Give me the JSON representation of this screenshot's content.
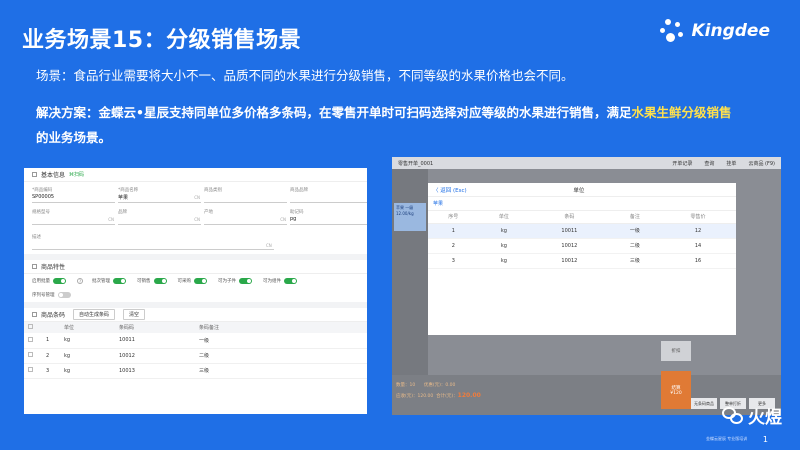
{
  "title": "业务场景15：分级销售场景",
  "brand": "Kingdee",
  "scene_text": "场景：食品行业需要将大小不一、品质不同的水果进行分级销售，不同等级的水果价格也会不同。",
  "solution_text": "解决方案：金蝶云•星辰支持同单位多价格多条码，在零售开单时可扫码选择对应等级的水果进行销售，满足",
  "solution_highlight": "水果生鲜分级销售",
  "solution_tail": "的业务场景。",
  "left": {
    "basic_title": "基本信息",
    "scan_label": "⌘扫码",
    "fields": [
      {
        "label": "*商品编码",
        "value": "SP00005",
        "suffix": ""
      },
      {
        "label": "*商品名称",
        "value": "苹果",
        "suffix": "CN"
      },
      {
        "label": "商品类别",
        "value": "",
        "suffix": ""
      },
      {
        "label": "商品品牌",
        "value": "",
        "suffix": ""
      },
      {
        "label": "规格型号",
        "value": "",
        "suffix": "CN"
      },
      {
        "label": "品牌",
        "value": "",
        "suffix": "CN"
      },
      {
        "label": "产地",
        "value": "",
        "suffix": "CN"
      },
      {
        "label": "助记码",
        "value": "pg",
        "suffix": ""
      }
    ],
    "desc_label": "描述",
    "desc_suffix": "CN",
    "attr_title": "商品特性",
    "toggles": [
      {
        "label": "启用批量",
        "on": true
      },
      {
        "label": "批次管理",
        "on": true
      },
      {
        "label": "可销售",
        "on": true
      },
      {
        "label": "可采购",
        "on": true
      },
      {
        "label": "可为子件",
        "on": true
      },
      {
        "label": "可为组件",
        "on": true
      }
    ],
    "serial_label": "序列号管理",
    "barcode_title": "商品条码",
    "auto_btn": "自动生成条码",
    "clear_btn": "清空",
    "barcode_headers": [
      "",
      "",
      "单位",
      "条码码",
      "条码备注"
    ],
    "barcode_rows": [
      {
        "no": "1",
        "unit": "kg",
        "code": "10011",
        "note": "一级"
      },
      {
        "no": "2",
        "unit": "kg",
        "code": "10012",
        "note": "二级"
      },
      {
        "no": "3",
        "unit": "kg",
        "code": "10013",
        "note": "三级"
      }
    ]
  },
  "right": {
    "topbar_left": "零售开单_0001",
    "topbar_actions": [
      "开单记录",
      "查询",
      "挂单",
      "云商品 (F9)"
    ],
    "side_label": "苹果 一级",
    "side_price": "12.00/kg",
    "modal": {
      "back": "〈 返回 (Esc)",
      "title": "单位",
      "tab": "苹果",
      "headers": [
        "序号",
        "单位",
        "条码",
        "备注",
        "零售价"
      ],
      "rows": [
        {
          "no": "1",
          "unit": "kg",
          "code": "10011",
          "note": "一级",
          "price": "12"
        },
        {
          "no": "2",
          "unit": "kg",
          "code": "10012",
          "note": "二级",
          "price": "14"
        },
        {
          "no": "3",
          "unit": "kg",
          "code": "10012",
          "note": "三级",
          "price": "16"
        }
      ]
    },
    "gray_btn": "折扣",
    "orange_btn_1": "结算",
    "orange_btn_2": "¥120",
    "bottom_info_1": "数量：10",
    "bottom_info_2": "应收(元)：120.00",
    "bottom_info_3": "优惠(元)：0.00",
    "bottom_info_4": "合计(元)：",
    "bottom_total": "120.00",
    "bottom_buttons": [
      "商品查询",
      "无条码商品",
      "整单打折",
      "更多"
    ]
  },
  "watermark": "火煜",
  "footer_small": "金蝶云星辰 专业版培训",
  "page_no": "1"
}
